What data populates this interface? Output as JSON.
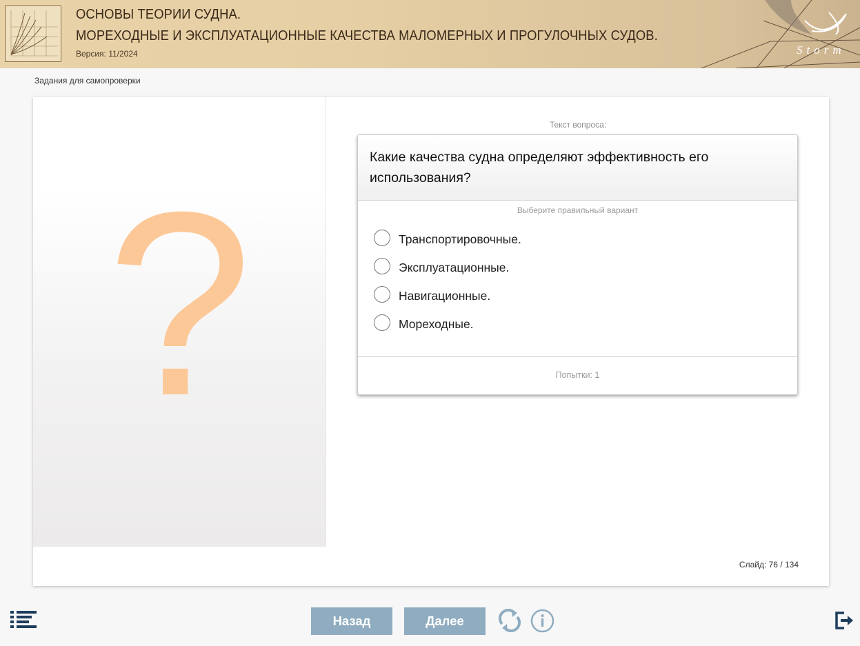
{
  "header": {
    "title_line1": "ОСНОВЫ ТЕОРИИ СУДНА.",
    "title_line2": "МОРЕХОДНЫЕ И ЭКСПЛУАТАЦИОННЫЕ КАЧЕСТВА МАЛОМЕРНЫХ И ПРОГУЛОЧНЫХ СУДОВ.",
    "version": "Версия: 11/2024",
    "brand": "Storm"
  },
  "breadcrumb": "Задания для самопроверки",
  "slide": {
    "placeholder_glyph": "?",
    "question_caption": "Текст вопроса:",
    "question_text": "Какие качества судна определяют эффективность его использования?",
    "hint": "Выберите правильный вариант",
    "options": [
      {
        "label": "Транспортировочные.",
        "selected": false
      },
      {
        "label": "Эксплуатационные.",
        "selected": false
      },
      {
        "label": "Навигационные.",
        "selected": false
      },
      {
        "label": "Мореходные.",
        "selected": false
      }
    ],
    "attempts": "Попытки: 1",
    "counter": "Слайд:  76 / 134"
  },
  "footer": {
    "back_label": "Назад",
    "next_label": "Далее",
    "icons": [
      "menu-icon",
      "reload-icon",
      "info-icon",
      "exit-icon"
    ]
  },
  "colors": {
    "nav_button": "#8facc0",
    "question_mark": "#fdc897",
    "icon_dark": "#1e3d5c",
    "icon_light": "#8facc0"
  }
}
